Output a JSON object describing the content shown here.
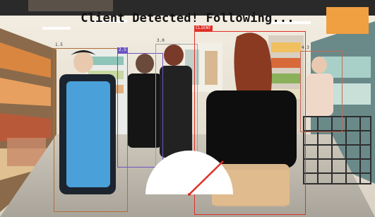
{
  "overlay": {
    "status_text": "Client Detected! Following...",
    "status_color": "#111111"
  },
  "detections": [
    {
      "id": "person-1",
      "tag": "1.5",
      "role": "person",
      "color": "#b0703a"
    },
    {
      "id": "person-2",
      "tag": "2.5",
      "role": "person",
      "color": "#6a55c0"
    },
    {
      "id": "person-3",
      "tag": "3.0",
      "role": "person",
      "color": "#a0a0a0"
    },
    {
      "id": "client",
      "tag": "CLIENT",
      "role": "client",
      "color": "#e03028"
    },
    {
      "id": "person-5",
      "tag": "4.3",
      "role": "person",
      "color": "#c06a55"
    }
  ],
  "hud": {
    "direction_indicator": "semicircle-gauge",
    "arrow_color": "#e03028",
    "gauge_color": "#ffffff"
  },
  "colors": {
    "floor": "#d8d2c6",
    "ceiling": "#efe9dc",
    "shelf_warm": "#c98a4a",
    "shelf_cool": "#7fb9b0"
  }
}
